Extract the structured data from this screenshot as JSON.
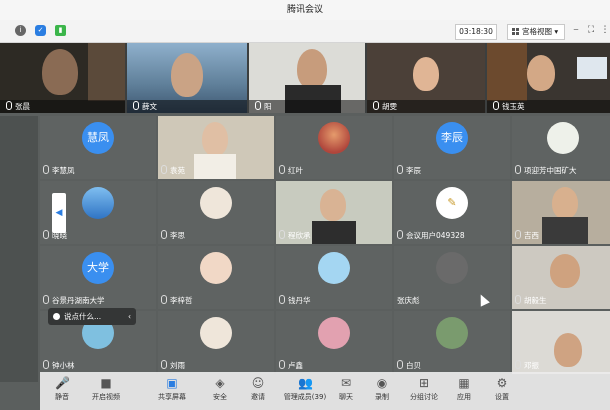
{
  "window": {
    "title": "腾讯会议"
  },
  "infobar": {
    "timer": "03:18:30",
    "view_label": "宫格视图",
    "view_caret": "▾",
    "icons": [
      "info-icon",
      "shield-icon",
      "signal-icon"
    ],
    "window_icons": [
      "minimize-icon",
      "fullscreen-icon",
      "more-icon"
    ]
  },
  "strip": [
    {
      "name": "张晨",
      "bg": "#2d2a24"
    },
    {
      "name": "薛文",
      "bg": "#6f8fa8"
    },
    {
      "name": "阳",
      "bg": "#d8d8d4"
    },
    {
      "name": "胡雯",
      "bg": "#4b4038"
    },
    {
      "name": "钱玉英",
      "bg": "#3a3530"
    }
  ],
  "grid": [
    {
      "name": "李慧凤",
      "avatar_text": "慧凤",
      "avatar_color": "#3a8ff0",
      "kind": "text"
    },
    {
      "name": "袁苑",
      "kind": "video",
      "bg": "#c9c2b3"
    },
    {
      "name": "红叶",
      "kind": "image",
      "avatar_color": "#c9584a"
    },
    {
      "name": "李辰",
      "avatar_text": "李辰",
      "avatar_color": "#3a8ff0",
      "kind": "text"
    },
    {
      "name": "项迎芳中国矿大",
      "kind": "image",
      "avatar_color": "#e8ece4"
    },
    {
      "name": "晓晓",
      "kind": "image",
      "avatar_color": "#3e86d6"
    },
    {
      "name": "李思",
      "kind": "image",
      "avatar_color": "#efe6da"
    },
    {
      "name": "程欣承",
      "kind": "video",
      "bg": "#c8cbbf"
    },
    {
      "name": "会议用户049328",
      "kind": "image",
      "avatar_color": "#ffffff"
    },
    {
      "name": "吉西",
      "kind": "video",
      "bg": "#b3aa9a"
    },
    {
      "name": "谷景丹湖南大学",
      "avatar_text": "大学",
      "avatar_color": "#3a8ff0",
      "kind": "text"
    },
    {
      "name": "李梓哲",
      "kind": "image",
      "avatar_color": "#f1d8c6"
    },
    {
      "name": "钱丹华",
      "kind": "image",
      "avatar_color": "#9ad0f0"
    },
    {
      "name": "张庆彪",
      "kind": "image",
      "avatar_color": "#6a6a6a"
    },
    {
      "name": "胡毅生",
      "kind": "video",
      "bg": "#c8c4bc"
    },
    {
      "name": "钟小林",
      "kind": "image",
      "avatar_color": "#7fc0e0"
    },
    {
      "name": "刘雨",
      "kind": "image",
      "avatar_color": "#efe6da"
    },
    {
      "name": "卢鑫",
      "kind": "image",
      "avatar_color": "#e2a1b0"
    },
    {
      "name": "白贝",
      "kind": "image",
      "avatar_color": "#7a9b6e"
    },
    {
      "name": "邓振",
      "kind": "video",
      "bg": "#d9d7d2"
    }
  ],
  "toast": {
    "text": "说点什么..."
  },
  "toolbar": {
    "items": [
      {
        "label": "静音",
        "icon": "mic-icon",
        "glyph": "🎤"
      },
      {
        "label": "开启视频",
        "icon": "camera-icon",
        "glyph": "■"
      },
      {
        "label": "共享屏幕",
        "icon": "share-screen-icon",
        "glyph": "▣",
        "active": true
      },
      {
        "label": "安全",
        "icon": "security-icon",
        "glyph": "◈"
      },
      {
        "label": "邀请",
        "icon": "invite-icon",
        "glyph": "☺"
      },
      {
        "label": "管理成员(39)",
        "icon": "members-icon",
        "glyph": "👥"
      },
      {
        "label": "聊天",
        "icon": "chat-icon",
        "glyph": "✉"
      },
      {
        "label": "录制",
        "icon": "record-icon",
        "glyph": "◉"
      },
      {
        "label": "分组讨论",
        "icon": "breakout-icon",
        "glyph": "⊞"
      },
      {
        "label": "应用",
        "icon": "apps-icon",
        "glyph": "▦"
      },
      {
        "label": "设置",
        "icon": "settings-icon",
        "glyph": "⚙"
      }
    ]
  },
  "colors": {
    "accent": "#2a7de1",
    "tile_bg": "#5f6362"
  }
}
